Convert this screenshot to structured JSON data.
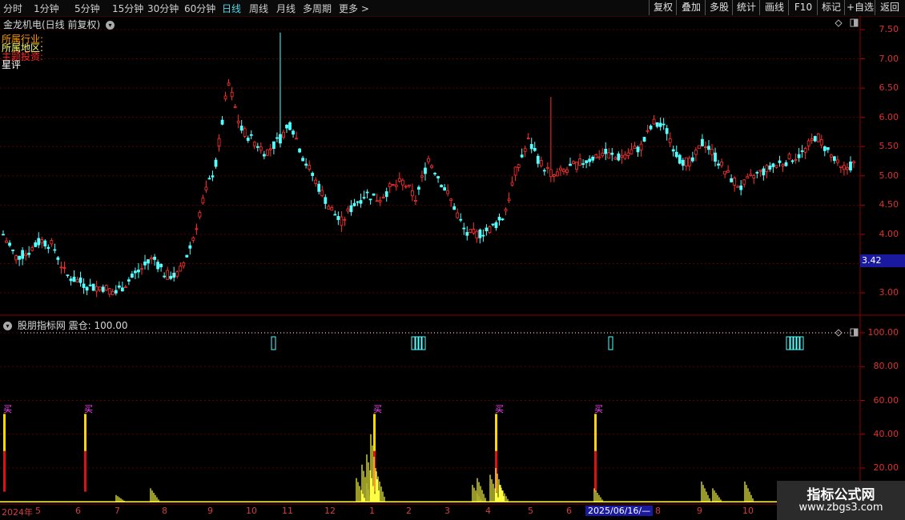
{
  "toolbar": {
    "tabs": [
      "分时",
      "1分钟",
      "5分钟",
      "15分钟",
      "30分钟",
      "60分钟",
      "日线",
      "周线",
      "月线",
      "多周期",
      "更多 >"
    ],
    "active_tab": "日线",
    "right_buttons": [
      "复权",
      "叠加",
      "多股",
      "统计",
      "画线",
      "F10",
      "+自选",
      "返回"
    ],
    "mark_button": "标记"
  },
  "main_chart": {
    "title": "金龙机电(日线 前复权)",
    "info_lines": [
      {
        "text": "所属行业:",
        "color": "#ff9900"
      },
      {
        "text": "所属地区:",
        "color": "#ffff66"
      },
      {
        "text": "主题投资:",
        "color": "#ff2222"
      },
      {
        "text": "星评",
        "color": "#ffffff"
      }
    ],
    "price_axis": [
      "7.50",
      "7.00",
      "6.50",
      "6.00",
      "5.50",
      "5.00",
      "4.50",
      "4.00",
      "3.50",
      "3.00"
    ],
    "current_price": "3.42"
  },
  "indicator": {
    "title": "股朋指标网  震仓: 100.00",
    "axis": [
      "100.00",
      "80.00",
      "60.00",
      "40.00",
      "20.00"
    ],
    "buy_label": "买"
  },
  "date_axis": [
    "2024年",
    "5",
    "6",
    "7",
    "8",
    "9",
    "10",
    "11",
    "12",
    "1",
    "2",
    "3",
    "4",
    "5",
    "6",
    "2025/06/16/—",
    "8",
    "9",
    "10"
  ],
  "watermark": {
    "title": "指标公式网",
    "url": "www.zbgs3.com"
  },
  "chart_data": {
    "type": "candlestick",
    "title": "金龙机电(日线 前复权)",
    "y_range": [
      2.8,
      7.6
    ],
    "price_ticks": [
      7.5,
      7.0,
      6.5,
      6.0,
      5.5,
      5.0,
      4.5,
      4.0,
      3.5,
      3.0
    ],
    "approx_close_path": [
      4.0,
      3.6,
      3.7,
      3.9,
      3.8,
      3.3,
      3.2,
      3.1,
      3.1,
      3.0,
      3.2,
      3.4,
      3.6,
      3.3,
      3.3,
      3.8,
      4.6,
      5.2,
      6.6,
      5.8,
      5.6,
      5.4,
      5.6,
      5.9,
      5.3,
      4.9,
      4.5,
      4.2,
      4.5,
      4.7,
      4.6,
      4.8,
      4.9,
      4.6,
      5.3,
      4.9,
      4.5,
      4.0,
      4.0,
      4.1,
      4.3,
      5.1,
      5.6,
      5.2,
      5.0,
      5.1,
      5.2,
      5.3,
      5.4,
      5.3,
      5.4,
      5.5,
      5.9,
      5.8,
      5.3,
      5.2,
      5.6,
      5.3,
      5.0,
      4.8,
      5.0,
      5.1,
      5.2,
      5.3,
      5.4,
      5.7,
      5.4,
      5.1,
      5.2
    ],
    "highs": {
      "max": 7.45,
      "recent_spike": 6.35
    },
    "indicator": {
      "name": "震仓",
      "value": 100.0,
      "y_range": [
        0,
        100
      ],
      "ticks": [
        100,
        80,
        60,
        40,
        20
      ],
      "buy_signal_count": 5,
      "dotted_level": 100
    }
  }
}
